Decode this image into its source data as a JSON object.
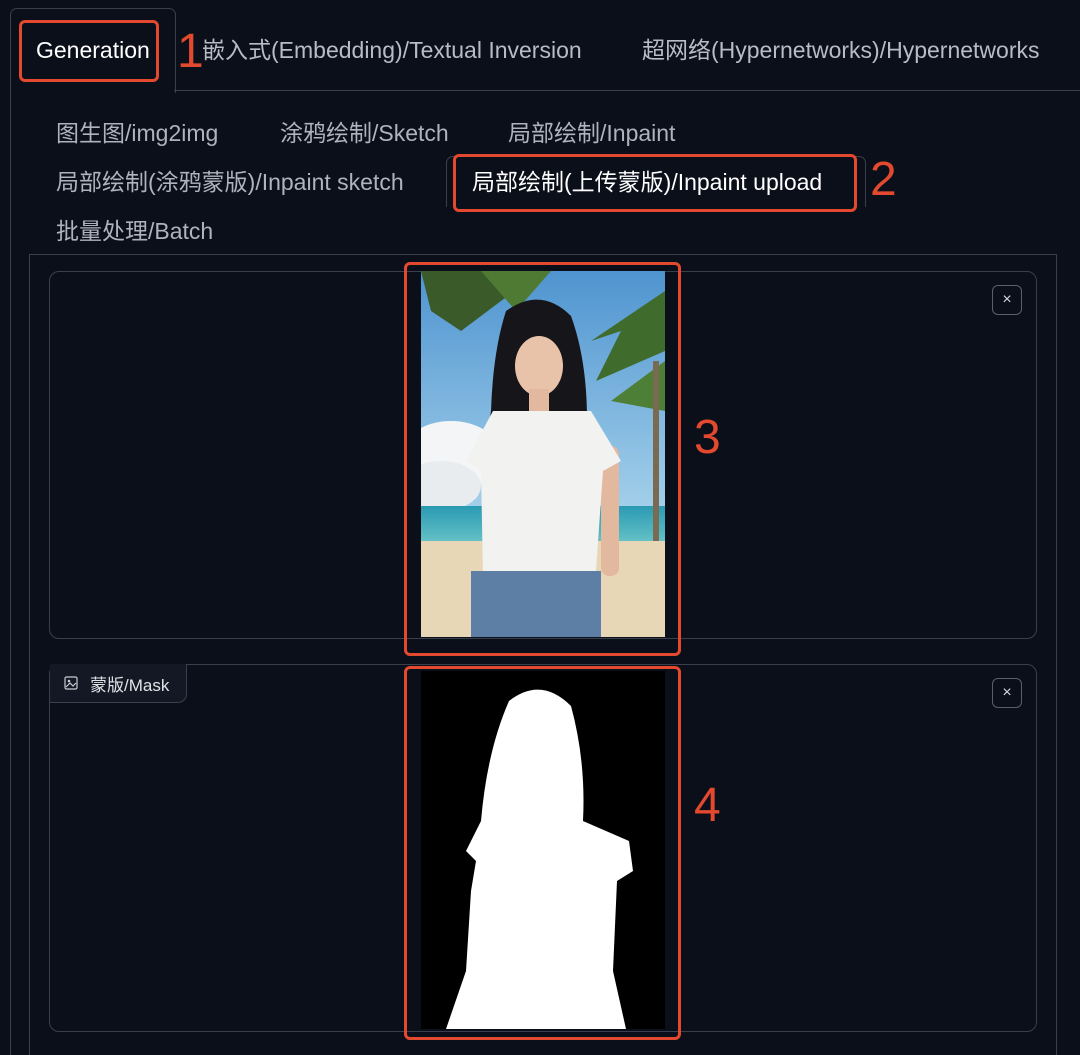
{
  "top_tabs": [
    {
      "label": "Generation"
    },
    {
      "label": "嵌入式(Embedding)/Textual Inversion"
    },
    {
      "label": "超网络(Hypernetworks)/Hypernetworks"
    }
  ],
  "sub_tabs": [
    {
      "label": "图生图/img2img"
    },
    {
      "label": "涂鸦绘制/Sketch"
    },
    {
      "label": "局部绘制/Inpaint"
    },
    {
      "label": "局部绘制(涂鸦蒙版)/Inpaint sketch"
    },
    {
      "label": "局部绘制(上传蒙版)/Inpaint upload"
    },
    {
      "label": "批量处理/Batch"
    }
  ],
  "source_image": {
    "close_icon": "×",
    "description_icon": "image-photo"
  },
  "mask_image": {
    "label": "蒙版/Mask",
    "close_icon": "×"
  },
  "annotations": [
    "1",
    "2",
    "3",
    "4"
  ],
  "colors": {
    "annotation": "#e2492f",
    "background": "#0b0f19",
    "border": "#3a3f4c"
  }
}
